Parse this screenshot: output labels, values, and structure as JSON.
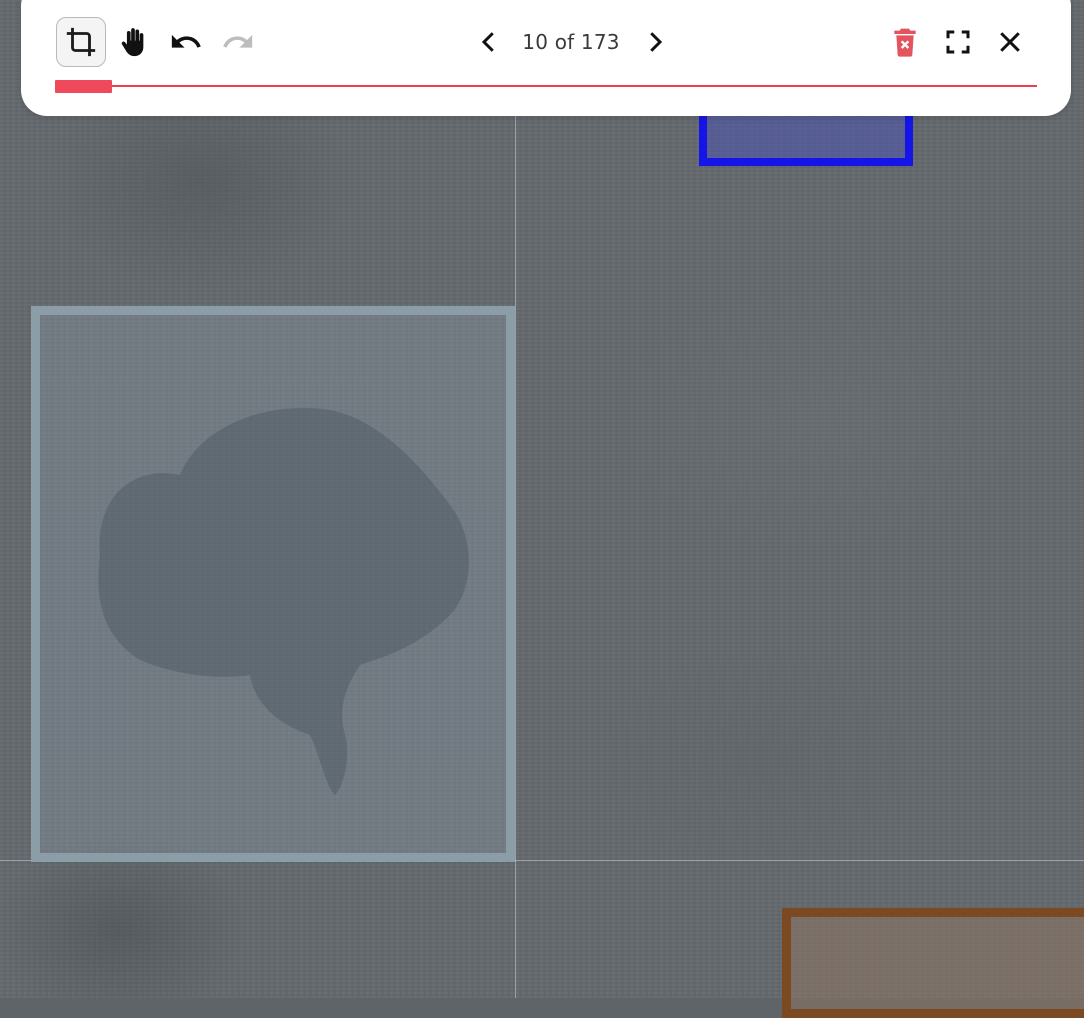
{
  "toolbar": {
    "tools": [
      {
        "name": "crop",
        "icon": "crop-icon",
        "active": true
      },
      {
        "name": "pan",
        "icon": "hand-icon",
        "active": false
      },
      {
        "name": "undo",
        "icon": "undo-icon",
        "enabled": true
      },
      {
        "name": "redo",
        "icon": "redo-icon",
        "enabled": false
      }
    ],
    "navigation": {
      "counter": "10 of 173",
      "prev_icon": "chevron-left-icon",
      "next_icon": "chevron-right-icon"
    },
    "actions": [
      {
        "name": "delete",
        "icon": "trash-icon"
      },
      {
        "name": "fullscreen",
        "icon": "fullscreen-icon"
      },
      {
        "name": "close",
        "icon": "close-icon"
      }
    ],
    "progress": {
      "fraction": 0.0578
    }
  },
  "annotations": [
    {
      "label": "selected",
      "color": "#8b9da7"
    },
    {
      "label": "blue",
      "color": "#1515e8"
    },
    {
      "label": "brown",
      "color": "#7b4a22"
    }
  ],
  "colors": {
    "accent": "#ef3e52",
    "delete_icon": "#e5545e",
    "disabled_icon": "#bdbdbd"
  }
}
